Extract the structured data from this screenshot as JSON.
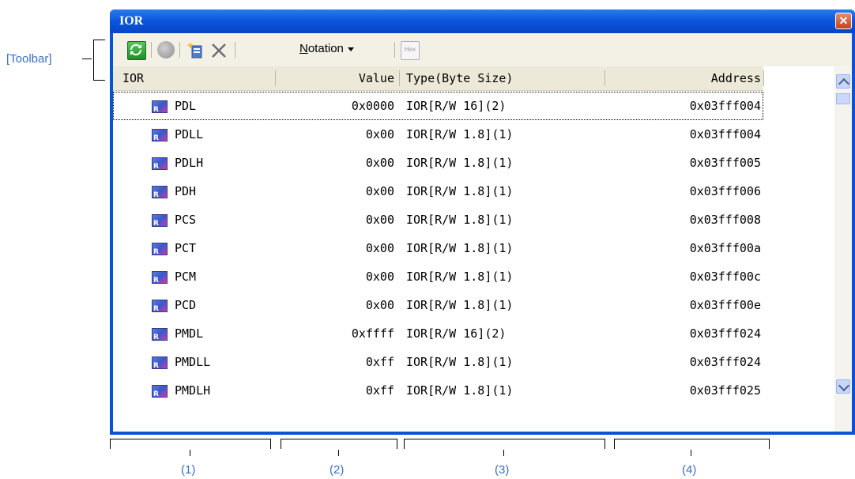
{
  "annotations": {
    "toolbar_label": "[Toolbar]",
    "columns": [
      "(1)",
      "(2)",
      "(3)",
      "(4)"
    ]
  },
  "window": {
    "title": "IOR",
    "close_glyph": "✕"
  },
  "toolbar": {
    "notation_label_underlined": "N",
    "notation_label_rest": "otation",
    "hex_label": "Hex",
    "icons": [
      "refresh-icon",
      "watch-icon",
      "new-item-icon",
      "delete-icon",
      "notation-menu",
      "hex-icon"
    ]
  },
  "grid": {
    "headers": [
      "IOR",
      "Value",
      "Type(Byte Size)",
      "Address"
    ],
    "rows": [
      {
        "name": "PDL",
        "value": "0x0000",
        "type": "IOR[R/W 16](2)",
        "address": "0x03fff004"
      },
      {
        "name": "PDLL",
        "value": "0x00",
        "type": "IOR[R/W 1.8](1)",
        "address": "0x03fff004"
      },
      {
        "name": "PDLH",
        "value": "0x00",
        "type": "IOR[R/W 1.8](1)",
        "address": "0x03fff005"
      },
      {
        "name": "PDH",
        "value": "0x00",
        "type": "IOR[R/W 1.8](1)",
        "address": "0x03fff006"
      },
      {
        "name": "PCS",
        "value": "0x00",
        "type": "IOR[R/W 1.8](1)",
        "address": "0x03fff008"
      },
      {
        "name": "PCT",
        "value": "0x00",
        "type": "IOR[R/W 1.8](1)",
        "address": "0x03fff00a"
      },
      {
        "name": "PCM",
        "value": "0x00",
        "type": "IOR[R/W 1.8](1)",
        "address": "0x03fff00c"
      },
      {
        "name": "PCD",
        "value": "0x00",
        "type": "IOR[R/W 1.8](1)",
        "address": "0x03fff00e"
      },
      {
        "name": "PMDL",
        "value": "0xffff",
        "type": "IOR[R/W 16](2)",
        "address": "0x03fff024"
      },
      {
        "name": "PMDLL",
        "value": "0xff",
        "type": "IOR[R/W 1.8](1)",
        "address": "0x03fff024"
      },
      {
        "name": "PMDLH",
        "value": "0xff",
        "type": "IOR[R/W 1.8](1)",
        "address": "0x03fff025"
      }
    ]
  }
}
